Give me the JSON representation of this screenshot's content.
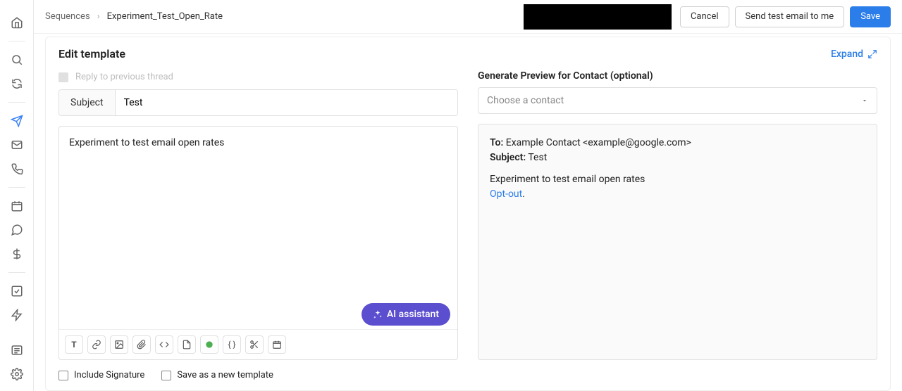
{
  "breadcrumb": {
    "root": "Sequences",
    "current": "Experiment_Test_Open_Rate"
  },
  "actions": {
    "cancel": "Cancel",
    "send_test": "Send test email to me",
    "save": "Save"
  },
  "header": {
    "title": "Edit template",
    "expand": "Expand"
  },
  "editor": {
    "reply_label": "Reply to previous thread",
    "subject_label": "Subject",
    "subject_value": "Test",
    "body": "Experiment to test email open rates",
    "ai_label": "AI assistant"
  },
  "preview": {
    "section_label": "Generate Preview for Contact (optional)",
    "placeholder": "Choose a contact",
    "to_label": "To:",
    "to_value": "Example Contact <example@google.com>",
    "subject_label": "Subject:",
    "subject_value": "Test",
    "body": "Experiment to test email open rates",
    "opt_out": "Opt-out"
  },
  "footer": {
    "include_signature": "Include Signature",
    "save_template": "Save as a new template"
  }
}
